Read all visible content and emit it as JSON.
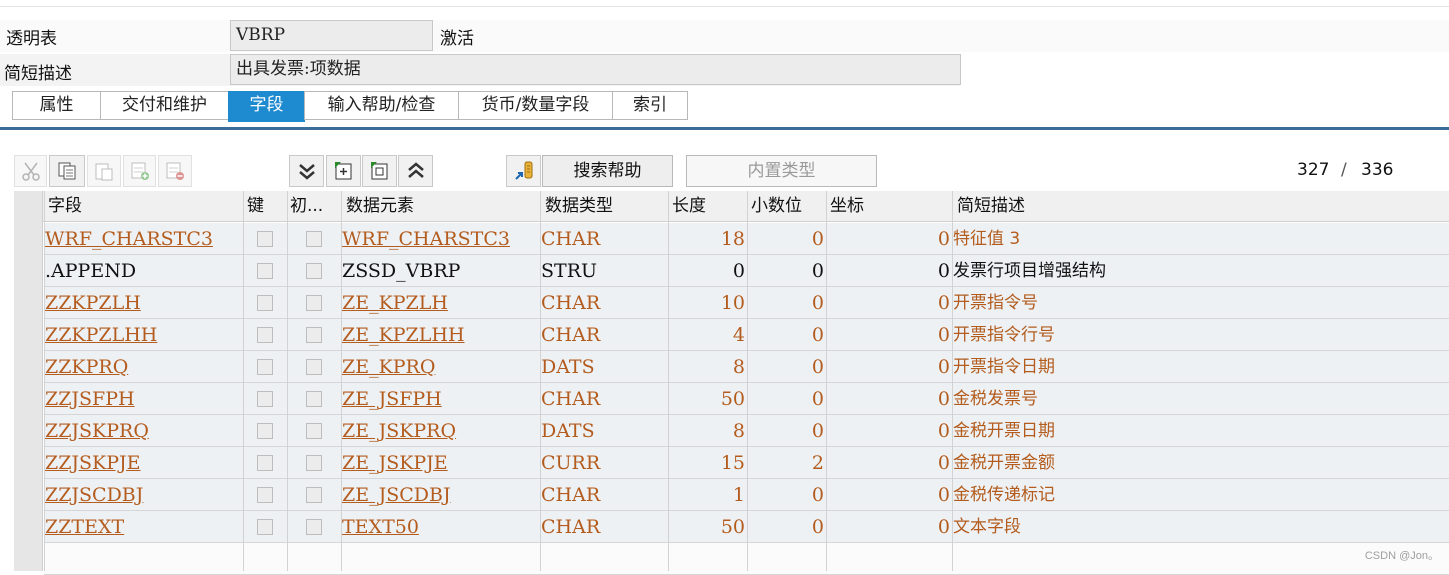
{
  "header": {
    "table_type_label": "透明表",
    "table_name": "VBRP",
    "status": "激活",
    "short_desc_label": "简短描述",
    "short_desc_value": "出具发票:项数据"
  },
  "tabs": [
    {
      "label": "属性",
      "active": false
    },
    {
      "label": "交付和维护",
      "active": false
    },
    {
      "label": "字段",
      "active": true
    },
    {
      "label": "输入帮助/检查",
      "active": false
    },
    {
      "label": "货币/数量字段",
      "active": false
    },
    {
      "label": "索引",
      "active": false
    }
  ],
  "toolbar": {
    "icons": [
      "scissors-icon",
      "copy-icon",
      "paste-icon",
      "insert-row-icon",
      "delete-row-icon",
      "scroll-bottom-icon",
      "expand-icon",
      "collapse-icon",
      "scroll-top-icon",
      "search-help-icon"
    ],
    "search_help_label": "搜索帮助",
    "builtin_type_label": "内置类型",
    "position_current": "327",
    "position_separator": "/",
    "position_total": "336"
  },
  "table": {
    "columns": [
      "字段",
      "键",
      "初...",
      "数据元素",
      "数据类型",
      "长度",
      "小数位",
      "坐标",
      "简短描述"
    ],
    "rows": [
      {
        "field": "WRF_CHARSTC3",
        "key": false,
        "init": false,
        "data_element": "WRF_CHARSTC3",
        "data_type": "CHAR",
        "length": "18",
        "decimals": "0",
        "coord": "0",
        "desc": "特征值 3"
      },
      {
        "field": ".APPEND",
        "key": false,
        "init": false,
        "data_element": "ZSSD_VBRP",
        "data_type": "STRU",
        "length": "0",
        "decimals": "0",
        "coord": "0",
        "desc": "发票行项目增强结构"
      },
      {
        "field": "ZZKPZLH",
        "key": false,
        "init": false,
        "data_element": "ZE_KPZLH",
        "data_type": "CHAR",
        "length": "10",
        "decimals": "0",
        "coord": "0",
        "desc": "开票指令号"
      },
      {
        "field": "ZZKPZLHH",
        "key": false,
        "init": false,
        "data_element": "ZE_KPZLHH",
        "data_type": "CHAR",
        "length": "4",
        "decimals": "0",
        "coord": "0",
        "desc": "开票指令行号"
      },
      {
        "field": "ZZKPRQ",
        "key": false,
        "init": false,
        "data_element": "ZE_KPRQ",
        "data_type": "DATS",
        "length": "8",
        "decimals": "0",
        "coord": "0",
        "desc": "开票指令日期"
      },
      {
        "field": "ZZJSFPH",
        "key": false,
        "init": false,
        "data_element": "ZE_JSFPH",
        "data_type": "CHAR",
        "length": "50",
        "decimals": "0",
        "coord": "0",
        "desc": "金税发票号"
      },
      {
        "field": "ZZJSKPRQ",
        "key": false,
        "init": false,
        "data_element": "ZE_JSKPRQ",
        "data_type": "DATS",
        "length": "8",
        "decimals": "0",
        "coord": "0",
        "desc": "金税开票日期"
      },
      {
        "field": "ZZJSKPJE",
        "key": false,
        "init": false,
        "data_element": "ZE_JSKPJE",
        "data_type": "CURR",
        "length": "15",
        "decimals": "2",
        "coord": "0",
        "desc": "金税开票金额"
      },
      {
        "field": "ZZJSCDBJ",
        "key": false,
        "init": false,
        "data_element": "ZE_JSCDBJ",
        "data_type": "CHAR",
        "length": "1",
        "decimals": "0",
        "coord": "0",
        "desc": "金税传递标记"
      },
      {
        "field": "ZZTEXT",
        "key": false,
        "init": false,
        "data_element": "TEXT50",
        "data_type": "CHAR",
        "length": "50",
        "decimals": "0",
        "coord": "0",
        "desc": "文本字段"
      }
    ]
  },
  "watermark": "CSDN @Jon。",
  "colors": {
    "accent": "#1e8ad0",
    "link": "#b35c1e",
    "tab_rule": "#3a6d99"
  }
}
